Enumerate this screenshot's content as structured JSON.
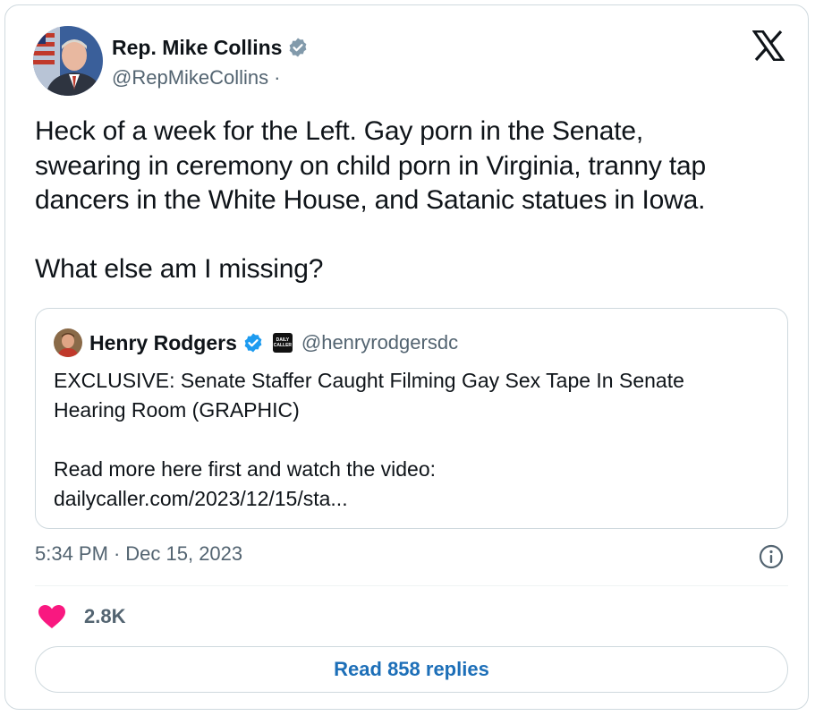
{
  "tweet": {
    "author": {
      "name": "Rep. Mike Collins",
      "handle": "@RepMikeCollins",
      "separator": "·"
    },
    "text_lines": [
      "Heck of a week for the Left. Gay porn in the Senate,",
      "swearing in ceremony on child porn in Virginia, tranny tap",
      "dancers in the White House, and Satanic statues in Iowa."
    ],
    "text_question": "What else am I missing?",
    "quote": {
      "author_name": "Henry Rodgers",
      "affiliate_badge": "DAILY CALLER",
      "author_handle": "@henryrodgersdc",
      "headline_lines": [
        "EXCLUSIVE: Senate Staffer Caught Filming Gay Sex Tape In Senate",
        "Hearing Room (GRAPHIC)"
      ],
      "read_more": "Read more here first and watch the video:",
      "link": "dailycaller.com/2023/12/15/sta..."
    },
    "time": "5:34 PM",
    "time_separator": "·",
    "date": "Dec 15, 2023",
    "likes": "2.8K",
    "replies_button": "Read 858 replies"
  },
  "colors": {
    "text_primary": "#0f1419",
    "text_secondary": "#536471",
    "border": "#cfd9de",
    "verified_gray": "#829aab",
    "verified_blue": "#1d9bf0",
    "like_pink": "#f91880",
    "link_blue": "#1d6fb8"
  },
  "icons": {
    "verified_gray": "verified-badge-gray-icon",
    "verified_blue": "verified-badge-blue-icon",
    "platform": "x-logo-icon",
    "info": "info-icon",
    "like": "heart-icon"
  }
}
